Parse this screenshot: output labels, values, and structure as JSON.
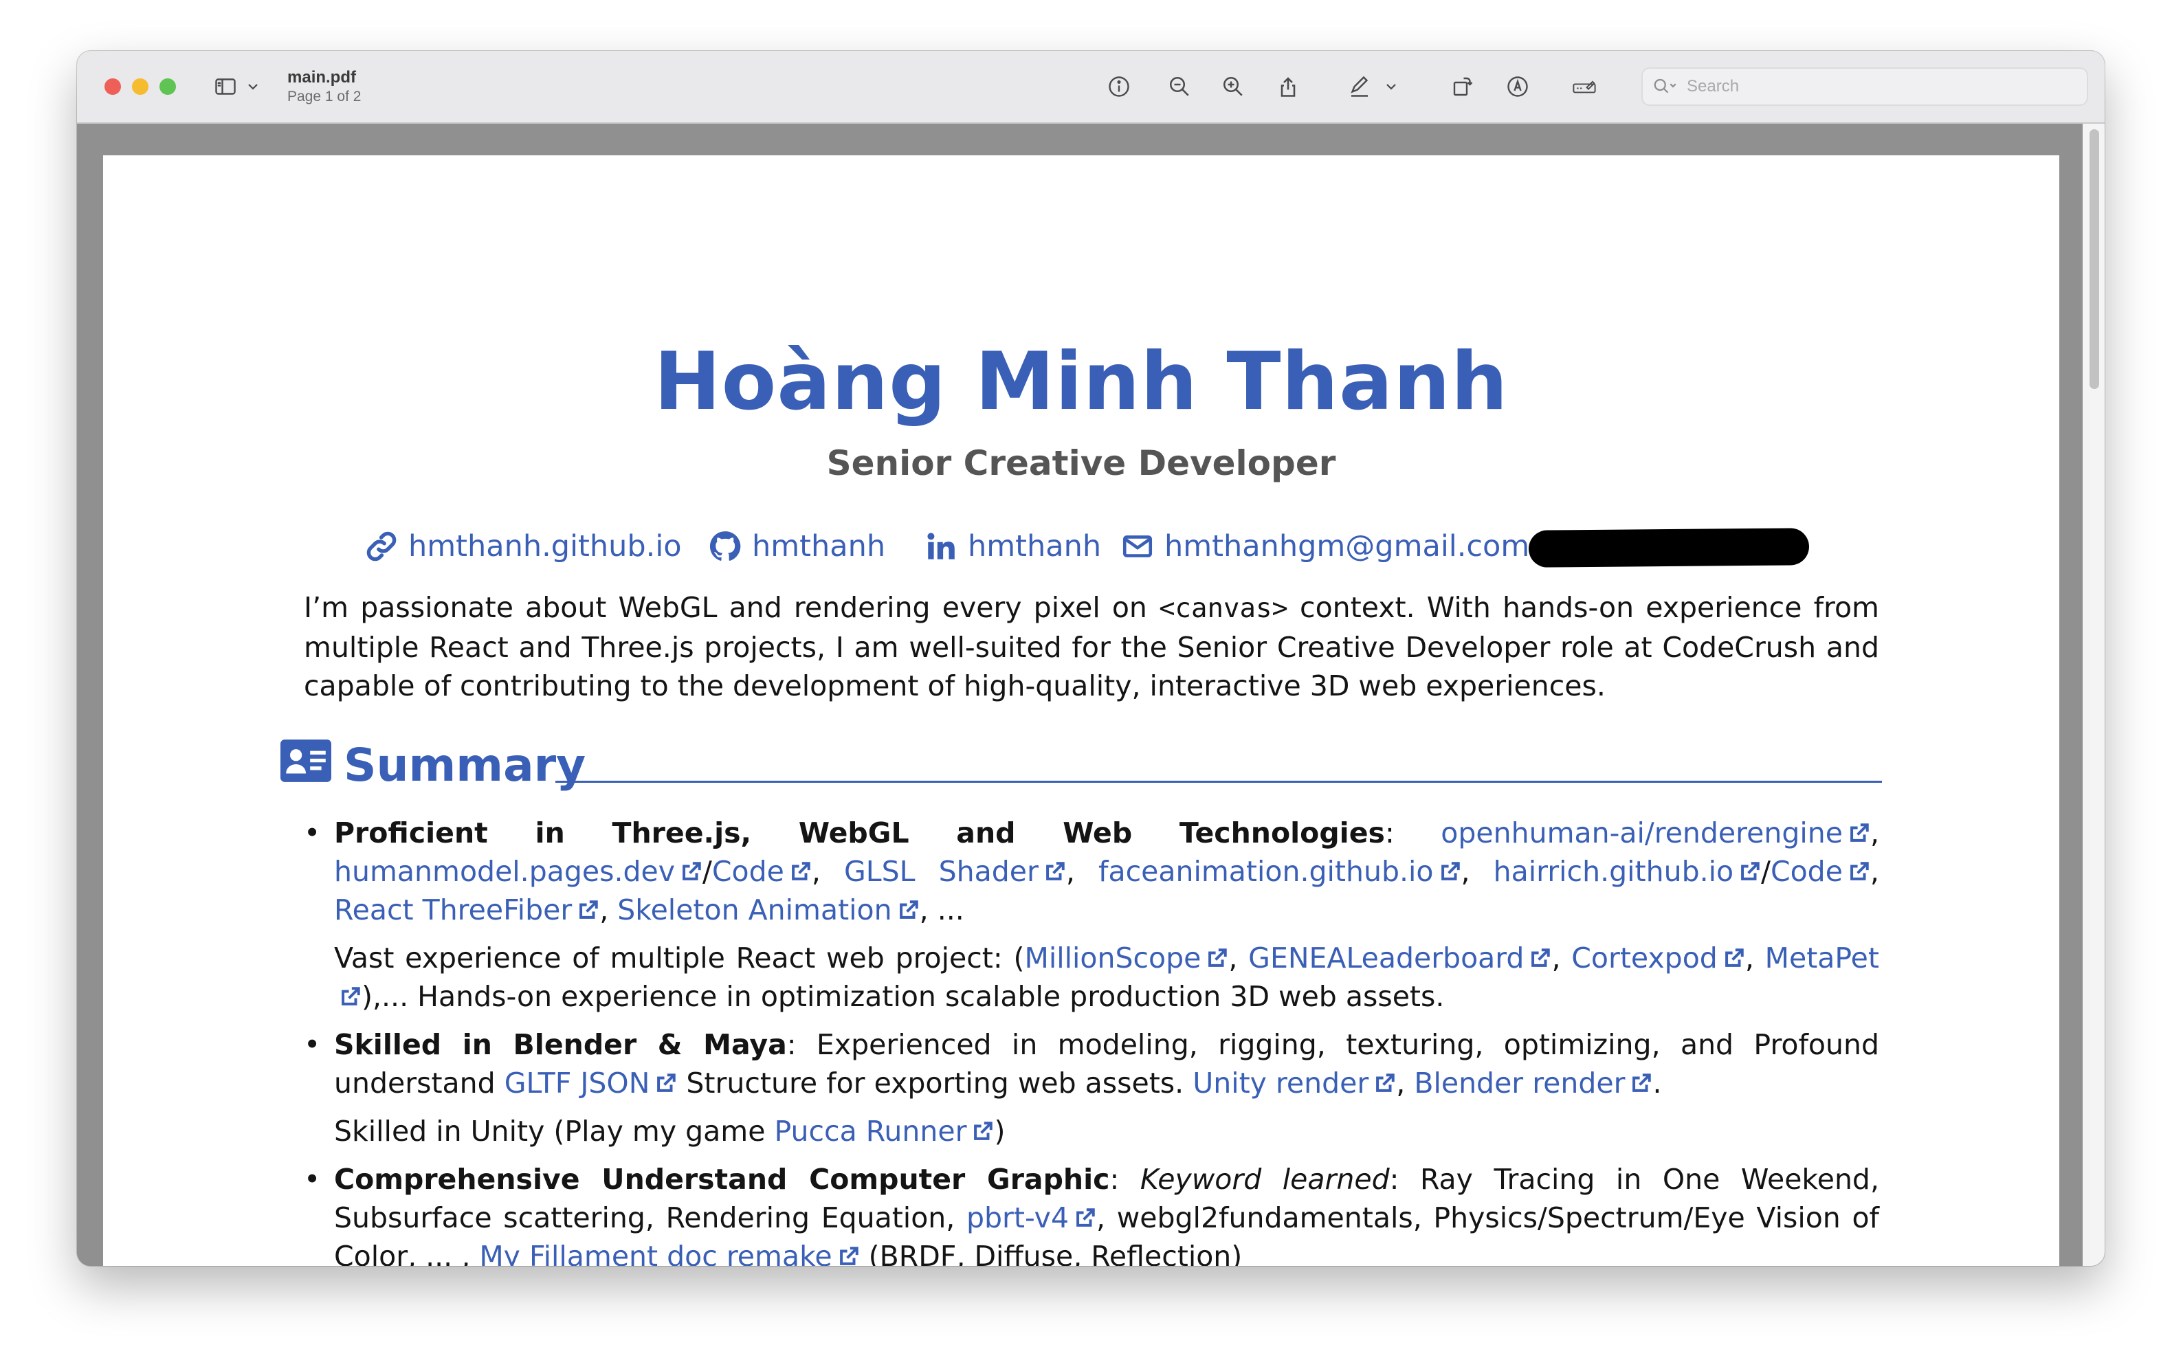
{
  "window": {
    "file_name": "main.pdf",
    "page_indicator": "Page 1 of 2",
    "search_placeholder": "Search"
  },
  "resume": {
    "name": "Hoàng Minh Thanh",
    "role": "Senior Creative Developer",
    "contacts": {
      "website": "hmthanh.github.io",
      "github": "hmthanh",
      "linkedin": "hmthanh",
      "email": "hmthanhgm@gmail.com"
    },
    "intro": {
      "before_code": "I’m passionate about WebGL and rendering every pixel on ",
      "code": "<canvas>",
      "after_code": " context.  With hands-on experience from multiple React and Three.js projects, I am well-suited for the Senior Creative Developer role at CodeCrush and capable of contributing to the development of high-quality, interactive 3D web experiences."
    },
    "summary": {
      "heading": "Summary",
      "bullet": "•",
      "item1": {
        "title": "Proficient in Three.js, WebGL and Web Technologies",
        "colon": ": ",
        "links": [
          "openhuman-ai/renderengine",
          "humanmodel.pages.dev",
          "Code",
          "GLSL Shader",
          "faceanimation.github.io",
          "hairrich.github.io",
          "Code",
          "React ThreeFiber",
          "Skeleton Animation"
        ],
        "sep_comma": ", ",
        "sep_slash": "/",
        "tail": ", ...",
        "sub_prefix": "Vast experience of multiple React web project: (",
        "sub_links": [
          "MillionScope",
          "GENEALeaderboard",
          "Cortexpod",
          "MetaPet"
        ],
        "sub_suffix": "),... Hands-on experience in optimization scalable production 3D web assets."
      },
      "item2": {
        "title": "Skilled in Blender & Maya",
        "text1": ": Experienced in modeling, rigging, texturing, optimizing, and Profound understand ",
        "link1": "GLTF JSON",
        "text2": " Structure for exporting web assets. ",
        "link2": "Unity render",
        "sep": ", ",
        "link3": "Blender render",
        "text3": ".",
        "sub_text": "Skilled in Unity (Play my game ",
        "sub_link": "Pucca Runner",
        "sub_end": ")"
      },
      "item3": {
        "title": "Comprehensive Understand Computer Graphic",
        "colon": ": ",
        "italic": "Keyword learned",
        "text1": ": Ray Tracing in One Weekend, Subsurface scattering, Rendering Equation, ",
        "link1": "pbrt-v4",
        "text2": ", webgl2fundamentals, Physics/Spectrum/Eye Vision of Color, ... , ",
        "link2": "My Fillament doc remake",
        "text3": " (BRDF, Diffuse, Reflection)"
      }
    }
  },
  "colors": {
    "accent": "#3a5fb6",
    "role_gray": "#555555",
    "titlebar": "#e9e8ea",
    "viewer_background": "#909090"
  },
  "icons": [
    "sidebar-toggle-icon",
    "chevron-down-icon",
    "info-icon",
    "zoom-out-icon",
    "zoom-in-icon",
    "share-icon",
    "highlight-pen-icon",
    "rotate-icon",
    "markup-icon",
    "form-fill-icon",
    "search-icon",
    "link-icon",
    "github-icon",
    "linkedin-icon",
    "envelope-icon",
    "id-card-icon",
    "external-link-icon"
  ]
}
